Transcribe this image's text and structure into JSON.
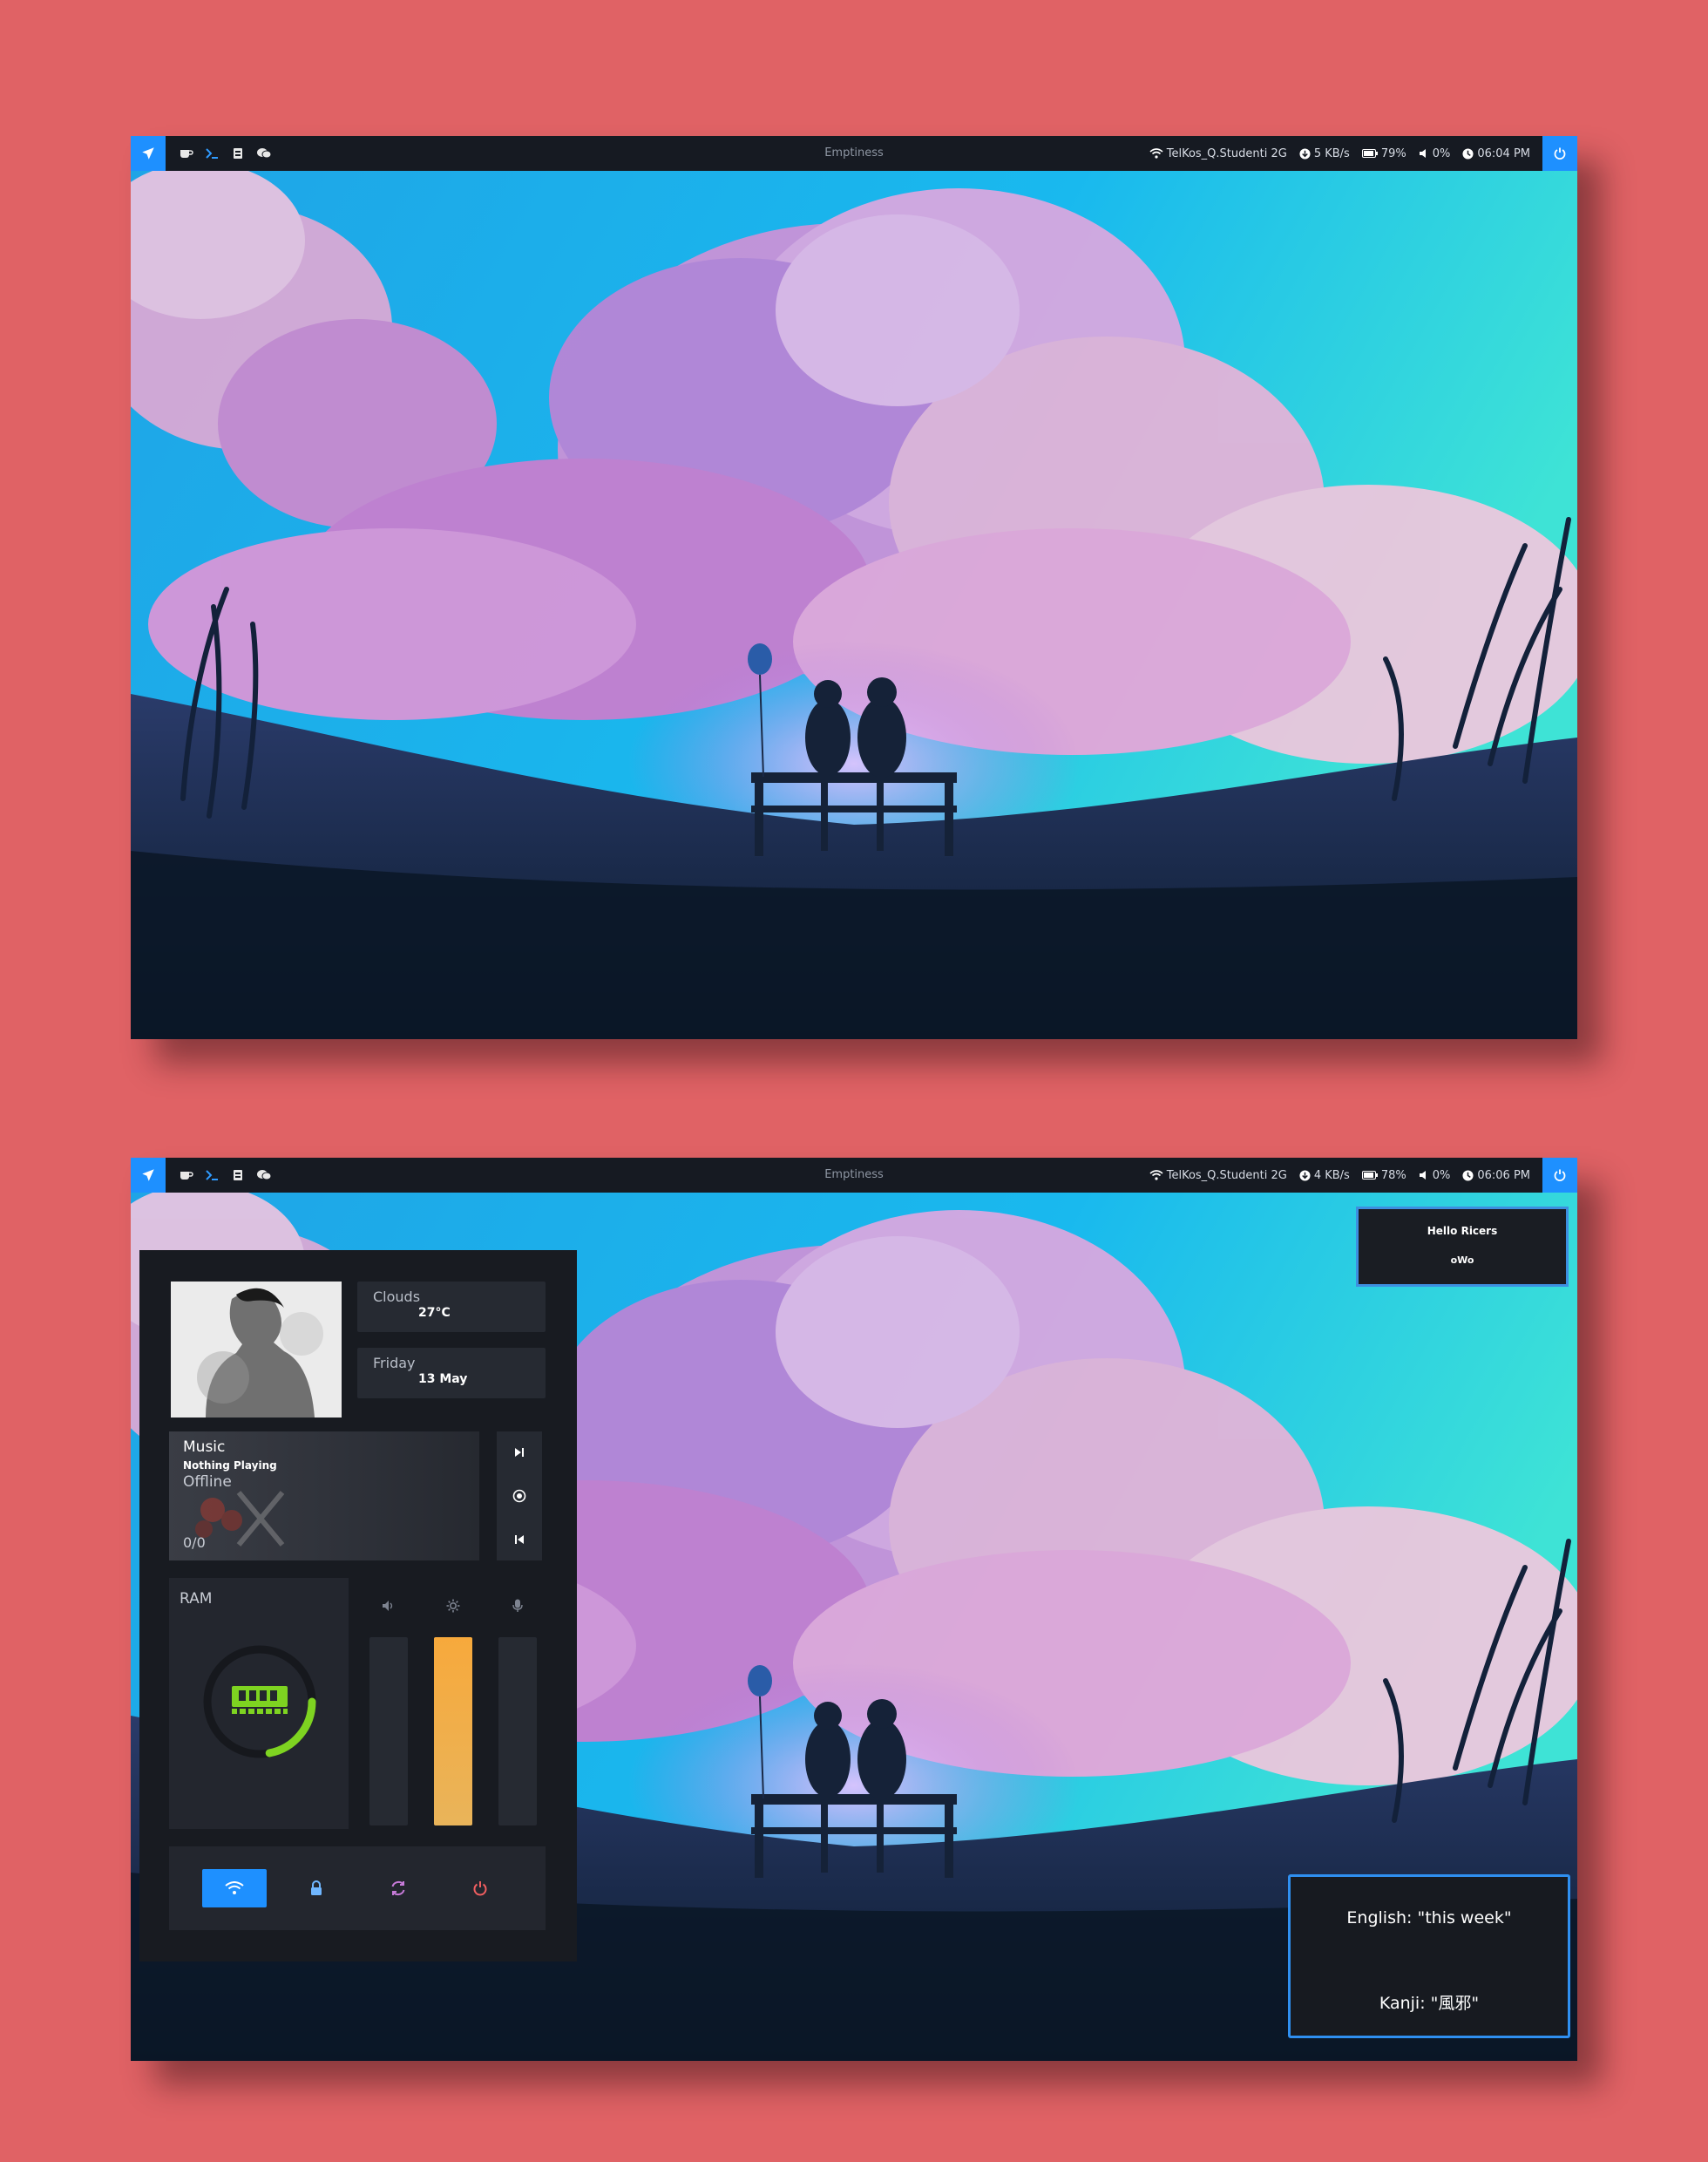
{
  "colors": {
    "page_background": "#e06265",
    "bar_background": "#161a22",
    "accent_blue": "#1e90ff",
    "ram_green": "#7ed321",
    "brightness_gradient": [
      "#f7a93c",
      "#e9b45a"
    ],
    "notification_border": "#3d8fe0",
    "lock_icon": "#6fb6ff",
    "refresh_icon": "#c77bd9",
    "power_icon": "#f05e60"
  },
  "screen1": {
    "topbar": {
      "launcher_icon": "rocket-icon",
      "app_icons": [
        "coffee-icon",
        "terminal-icon",
        "files-icon",
        "chat-icon"
      ],
      "title": "Emptiness",
      "wifi_name": "TelKos_Q.Studenti 2G",
      "net_speed": "5 KB/s",
      "battery": "79%",
      "volume": "0%",
      "time": "06:04 PM",
      "power_icon": "power-icon"
    }
  },
  "screen2": {
    "topbar": {
      "launcher_icon": "rocket-icon",
      "app_icons": [
        "coffee-icon",
        "terminal-icon",
        "files-icon",
        "chat-icon"
      ],
      "title": "Emptiness",
      "wifi_name": "TelKos_Q.Studenti 2G",
      "net_speed": "4 KB/s",
      "battery": "78%",
      "volume": "0%",
      "time": "06:06 PM",
      "power_icon": "power-icon"
    },
    "dashboard": {
      "weather": {
        "label": "Clouds",
        "value": "27°C"
      },
      "date": {
        "label": "Friday",
        "value": "13 May"
      },
      "music": {
        "title": "Music",
        "track": "Nothing Playing",
        "status": "Offline",
        "position": "0/0",
        "controls": [
          "next-icon",
          "play-pause-icon",
          "previous-icon"
        ]
      },
      "ram": {
        "label": "RAM",
        "usage_fraction": 0.22
      },
      "sliders": [
        {
          "icon": "volume-icon",
          "level": 0
        },
        {
          "icon": "brightness-icon",
          "level": 1.0
        },
        {
          "icon": "microphone-icon",
          "level": 0
        }
      ],
      "quick_actions": [
        "wifi-icon",
        "lock-icon",
        "refresh-icon",
        "power-icon"
      ]
    },
    "notifications": {
      "hello": {
        "line1": "Hello Ricers",
        "line2": "oWo"
      },
      "word": {
        "english": "English: \"this week\"",
        "kanji": "Kanji: \"風邪\""
      }
    }
  }
}
